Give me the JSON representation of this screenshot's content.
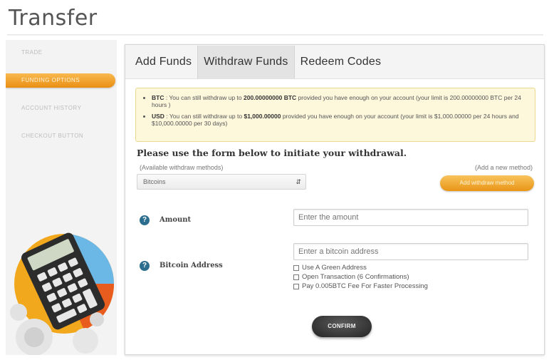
{
  "page": {
    "title": "Transfer"
  },
  "sidebar": {
    "items": [
      {
        "label": "TRADE"
      },
      {
        "label": "FUNDING OPTIONS"
      },
      {
        "label": "ACCOUNT HISTORY"
      },
      {
        "label": "CHECKOUT BUTTON"
      }
    ],
    "active_index": 1,
    "illustration": "calculator-illustration"
  },
  "tabs": [
    {
      "label": "Add Funds"
    },
    {
      "label": "Withdraw Funds"
    },
    {
      "label": "Redeem Codes"
    }
  ],
  "active_tab": 1,
  "notice": {
    "btc": {
      "currency": "BTC",
      "pre": " : You can still withdraw up to ",
      "amount": "200.00000000 BTC",
      "post": " provided you have enough on your account (your limit is 200.00000000 BTC per 24 hours )"
    },
    "usd": {
      "currency": "USD",
      "pre": " : You can still withdraw up to ",
      "amount": "$1,000.00000",
      "post": " provided you have enough on your account (your limit is $1,000.00000 per 24 hours and $10,000.00000 per 30 days)"
    }
  },
  "form": {
    "heading": "Please use the form below to initiate your withdrawal.",
    "methods_label": "(Available withdraw methods)",
    "add_method_link": "(Add a new method)",
    "method_selected": "Bitcoins",
    "add_method_button": "Add withdraw method",
    "amount_label": "Amount",
    "amount_placeholder": "Enter the amount",
    "address_label": "Bitcoin Address",
    "address_placeholder": "Enter a bitcoin address",
    "options": [
      "Use A Green Address",
      "Open Transaction (6 Confirmations)",
      "Pay 0.005BTC Fee For Faster Processing"
    ],
    "confirm_button": "CONFIRM"
  },
  "colors": {
    "accent": "#ea8e14",
    "help": "#2b6d8e",
    "notice_bg": "#fdf7dc"
  }
}
